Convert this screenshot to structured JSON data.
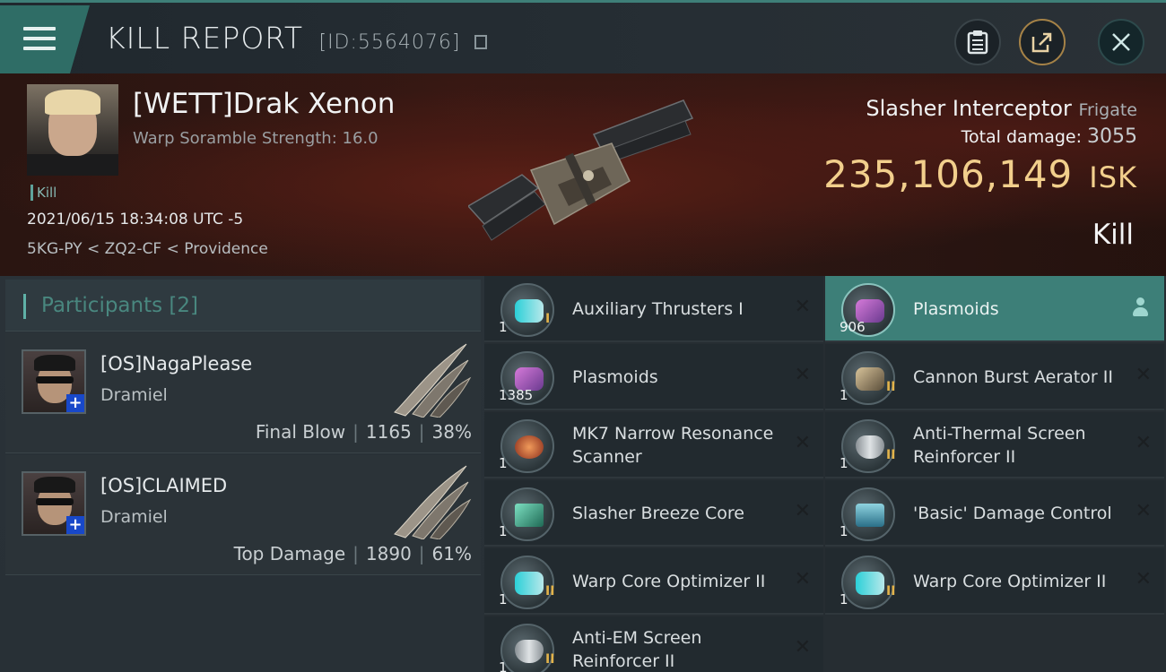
{
  "header": {
    "title": "KILL REPORT",
    "report_id": "[ID:5564076]"
  },
  "victim": {
    "name": "[WETT]Drak Xenon",
    "scramble": "Warp Soramble Strength: 16.0",
    "tag": "Kill",
    "datetime": "2021/06/15 18:34:08 UTC -5",
    "location": "5KG-PY < ZQ2-CF < Providence",
    "ship_name": "Slasher Interceptor",
    "ship_class": "Frigate",
    "total_damage_label": "Total damage:",
    "total_damage": "3055",
    "isk_value": "235,106,149",
    "isk_unit": "ISK",
    "result": "Kill"
  },
  "participants": {
    "title": "Participants [2]",
    "list": [
      {
        "name": "[OS]NagaPlease",
        "ship": "Dramiel",
        "role": "Final Blow",
        "damage": "1165",
        "percent": "38%"
      },
      {
        "name": "[OS]CLAIMED",
        "ship": "Dramiel",
        "role": "Top Damage",
        "damage": "1890",
        "percent": "61%"
      }
    ]
  },
  "items": {
    "left": [
      {
        "name": "Auxiliary Thrusters I",
        "qty": "1",
        "tier": "I",
        "icon": "thruster-icon"
      },
      {
        "name": "Plasmoids",
        "qty": "1385",
        "tier": "",
        "icon": "plasmoid-icon"
      },
      {
        "name": "MK7 Narrow Resonance Scanner",
        "qty": "1",
        "tier": "",
        "icon": "scanner-icon"
      },
      {
        "name": "Slasher Breeze Core",
        "qty": "1",
        "tier": "",
        "icon": "core-icon"
      },
      {
        "name": "Warp Core Optimizer II",
        "qty": "1",
        "tier": "II",
        "icon": "thruster-icon"
      },
      {
        "name": "Anti-EM Screen Reinforcer II",
        "qty": "1",
        "tier": "II",
        "icon": "shield-icon"
      }
    ],
    "right": [
      {
        "name": "Plasmoids",
        "qty": "906",
        "tier": "",
        "icon": "plasmoid-icon",
        "highlight": true
      },
      {
        "name": "Cannon Burst Aerator II",
        "qty": "1",
        "tier": "II",
        "icon": "aerator-icon"
      },
      {
        "name": "Anti-Thermal Screen Reinforcer II",
        "qty": "1",
        "tier": "II",
        "icon": "shield-icon"
      },
      {
        "name": "'Basic' Damage Control",
        "qty": "1",
        "tier": "",
        "icon": "damage-control-icon"
      },
      {
        "name": "Warp Core Optimizer II",
        "qty": "1",
        "tier": "II",
        "icon": "thruster-icon"
      }
    ]
  },
  "colors": {
    "accent": "#3d7f78",
    "isk": "#f2cf8c",
    "tier": "#e2b34b"
  }
}
